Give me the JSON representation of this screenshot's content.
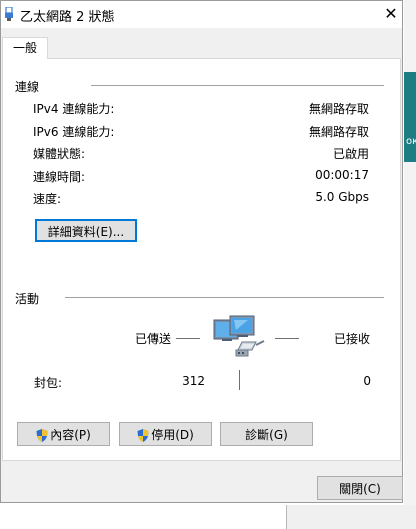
{
  "window": {
    "title": "乙太網路 2 狀態",
    "close_glyph": "✕"
  },
  "tab": {
    "label": "一般"
  },
  "connection": {
    "heading": "連線",
    "rows": [
      {
        "label": "IPv4 連線能力:",
        "value": "無網路存取"
      },
      {
        "label": "IPv6 連線能力:",
        "value": "無網路存取"
      },
      {
        "label": "媒體狀態:",
        "value": "已啟用"
      },
      {
        "label": "連線時間:",
        "value": "00:00:17"
      },
      {
        "label": "速度:",
        "value": "5.0 Gbps"
      }
    ],
    "details_button": "詳細資料(E)..."
  },
  "activity": {
    "heading": "活動",
    "sent_label": "已傳送",
    "received_label": "已接收",
    "packets_label": "封包:",
    "packets_sent": "312",
    "packets_received": "0"
  },
  "actions": {
    "properties": "內容(P)",
    "disable": "停用(D)",
    "diagnose": "診斷(G)"
  },
  "footer": {
    "close_button": "關閉(C)"
  },
  "background": {
    "glyph": "ок"
  },
  "colors": {
    "focus_border": "#0078d7",
    "shield_blue": "#2a6ccf",
    "shield_yellow": "#f1c232"
  },
  "icons": {
    "network": "network-computers-icon",
    "shield": "uac-shield-icon",
    "title": "ethernet-adapter-icon"
  }
}
